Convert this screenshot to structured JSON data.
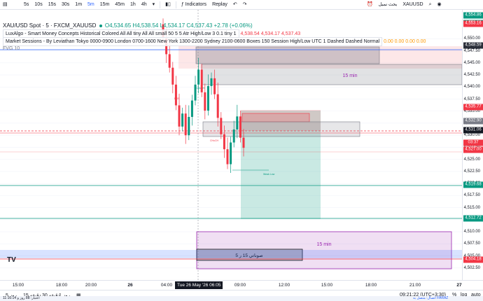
{
  "toolbar": {
    "intervals": [
      "5s",
      "10s",
      "15s",
      "30s",
      "1m",
      "5m",
      "15m",
      "45m",
      "1h",
      "4h"
    ],
    "active_interval": "5m",
    "indicators_label": "Indicators",
    "replay_label": "Replay",
    "symbol_search": "XAUUSD",
    "symbol_search_caption": "بحث نمبل"
  },
  "legend": {
    "title": "XAU/USD Spot · 5 · FXCM_XAUUSD",
    "ohlc": "O4,534.65 H4,538.54 L4,534.17 C4,537.43 +2.78 (+0.06%)",
    "indicator1": "LuxAlgo - Smart Money Concepts Historical Colored All All tiny All All small 50 5 5 Atr High/Low 3 0.1 tiny 1",
    "indicator1_values": "4,538.54 4,534.17 4,537.43",
    "indicator2": "Market Sessions - By Leviathan Tokyo 0000-0900 London 0700-1600 New York 1300-2200 Sydney 2100-0600 Boxes 150 Session High/Low UTC 1 Dashed Dashed Normal",
    "indicator2_values": "0.00 0.00 0.00 0.00",
    "fvg": "FVG 10"
  },
  "chart_labels": {
    "box_15min_top": "15 min",
    "box_15min_bottom": "15 min",
    "session_label": "صوناتي 15 ر 5",
    "choch1": "CHoCH",
    "choch2": "CHoCH",
    "weak_low": "Weak Low",
    "bos": "BOS"
  },
  "price_axis": {
    "ticks": [
      "4,550.00",
      "4,547.50",
      "4,545.00",
      "4,542.50",
      "4,540.00",
      "4,537.50",
      "4,535.00",
      "4,532.50",
      "4,530.00",
      "4,527.50",
      "4,525.00",
      "4,522.50",
      "4,520.00",
      "4,517.50",
      "4,515.00",
      "4,512.50",
      "4,510.00",
      "4,507.50",
      "4,505.00",
      "4,502.50"
    ],
    "tags": [
      {
        "text": "4,554.86",
        "color": "#089981"
      },
      {
        "text": "4,553.29",
        "color": "#089981"
      },
      {
        "text": "4,553.16",
        "color": "#f23645"
      },
      {
        "text": "4,548.59",
        "color": "#2a2e39"
      },
      {
        "text": "4,535.77",
        "color": "#f23645"
      },
      {
        "text": "4,532.90",
        "color": "#787b86"
      },
      {
        "text": "4,531.06",
        "color": "#131722"
      },
      {
        "text": "4,527.00",
        "color": "#f23645"
      },
      {
        "text": "03:37",
        "color": "#f23645"
      },
      {
        "text": "4,527.00",
        "color": "#f23645"
      },
      {
        "text": "4,519.68",
        "color": "#089981"
      },
      {
        "text": "4,512.81",
        "color": "#2a2e39"
      },
      {
        "text": "4,512.72",
        "color": "#089981"
      },
      {
        "text": "4,504.18",
        "color": "#f23645"
      }
    ]
  },
  "time_axis": {
    "ticks": [
      "15:00",
      "18:00",
      "20:00",
      "26",
      "04:00",
      "09:00",
      "12:00",
      "15:00",
      "18:00",
      "21:00",
      "27"
    ],
    "crosshair_date": "Tue 26 May '26",
    "crosshair_time": "06:05"
  },
  "bottom_bar": {
    "ranges": [
      "5 يوم",
      "15 يوم",
      "30 يوم",
      "1 روز",
      "1 ماه"
    ],
    "range_labels": [
      "روز 5",
      "دقيقه 15",
      "دقيقه 30",
      "روز 1",
      "ماه 1"
    ],
    "clock": "09:21:22 (UTC+3:30)",
    "percent": "%",
    "log": "log",
    "auto": "auto"
  },
  "status_bar": {
    "left": "اعتبار: 88 روز و 11:16:14",
    "right": "اتصال: متصل به FARAZ"
  },
  "colors": {
    "up": "#089981",
    "down": "#f23645",
    "blue_line": "#2962ff",
    "green_line": "#089981",
    "purple": "#9c27b0"
  },
  "chart_data": {
    "type": "candlestick",
    "symbol": "XAU/USD",
    "interval": "5m",
    "ylim": [
      4500,
      4556
    ],
    "levels": {
      "blue_line": 4549.5,
      "red_dashed": 4531.06,
      "red_line": 4527.0,
      "green_line_1": 4519.68,
      "green_line_2": 4512.72,
      "red_low_line": 4504.18
    },
    "candles_close": [
      4550.2,
      4546.8,
      4544.0,
      4540.5,
      4536.2,
      4531.8,
      4534.5,
      4530.0,
      4533.8,
      4537.2,
      4540.5,
      4543.6,
      4538.9,
      4535.1,
      4540.2,
      4541.8,
      4538.5,
      4533.6,
      4530.2,
      4527.1,
      4524.0,
      4528.5,
      4531.2,
      4533.9,
      4529.5,
      4527.4
    ]
  }
}
